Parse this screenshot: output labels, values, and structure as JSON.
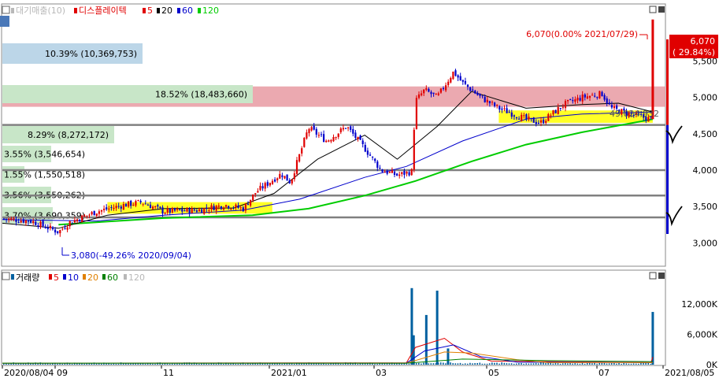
{
  "price_panel": {
    "legend": [
      {
        "label": "대기매출(10)",
        "color": "#b8b8b8"
      },
      {
        "label": "디스플레이텍",
        "color": "#e00000"
      },
      {
        "label": "5",
        "color": "#e00000"
      },
      {
        "label": "20",
        "color": "#000000"
      },
      {
        "label": "60",
        "color": "#0000cc"
      },
      {
        "label": "120",
        "color": "#00cc00"
      }
    ],
    "yaxis_ticks": [
      "5,500",
      "5,000",
      "4,500",
      "4,000",
      "3,500",
      "3,000"
    ],
    "current_price_label": "6,070",
    "current_change_label": "( 29.84%)",
    "high_annotation": "6,070(0.00% 2021/07/29)",
    "low_annotation": "3,080(-49.26% 2020/09/04)",
    "ma_readout": "49,024,932",
    "volume_profile": [
      {
        "label": "10.39% (10,369,753)",
        "color": "#bcd6e8"
      },
      {
        "label": "18.52% (18,483,660)",
        "color": "#c8e6c8"
      },
      {
        "label": "8.29% (8,272,172)",
        "color": "#c8e6c8"
      },
      {
        "label": "3.55% (3,546,654)",
        "color": "#c8e6c8"
      },
      {
        "label": "1.55% (1,550,518)",
        "color": "#c8e6c8"
      },
      {
        "label": "3.56% (3,550,262)",
        "color": "#c8e6c8"
      },
      {
        "label": "3.70% (3,690,359)",
        "color": "#c8e6c8"
      }
    ],
    "colors": {
      "up": "#e00000",
      "down": "#0000cc",
      "ma5": "#e00000",
      "ma20": "#000000",
      "ma60": "#0000cc",
      "ma120": "#00cc00"
    }
  },
  "volume_panel": {
    "legend": [
      {
        "label": "거래량",
        "color": "#000000"
      },
      {
        "label": "5",
        "color": "#e00000"
      },
      {
        "label": "10",
        "color": "#0000cc"
      },
      {
        "label": "20",
        "color": "#e08000"
      },
      {
        "label": "60",
        "color": "#008000"
      },
      {
        "label": "120",
        "color": "#b8b8b8"
      }
    ],
    "yaxis_ticks": [
      "12,000K",
      "6,000K",
      "0K"
    ]
  },
  "xaxis_ticks": [
    "2020/08/04",
    "09",
    "11",
    "2021/01",
    "03",
    "05",
    "07",
    "2021/08/05"
  ],
  "chart_data": {
    "type": "candlestick",
    "price_ylim": [
      2700,
      6100
    ],
    "volume_ylim": [
      0,
      16000
    ],
    "date_range": [
      "2020/08/04",
      "2021/08/05"
    ],
    "price_path": [
      [
        "2020/08/04",
        3330
      ],
      [
        "2020/08/20",
        3300
      ],
      [
        "2020/09/04",
        3150
      ],
      [
        "2020/09/10",
        3280
      ],
      [
        "2020/09/25",
        3430
      ],
      [
        "2020/10/10",
        3520
      ],
      [
        "2020/10/20",
        3560
      ],
      [
        "2020/11/01",
        3430
      ],
      [
        "2020/11/20",
        3450
      ],
      [
        "2020/12/05",
        3520
      ],
      [
        "2020/12/15",
        3470
      ],
      [
        "2020/12/22",
        3700
      ],
      [
        "2021/01/05",
        3950
      ],
      [
        "2021/01/10",
        3830
      ],
      [
        "2021/01/20",
        4580
      ],
      [
        "2021/01/30",
        4400
      ],
      [
        "2021/02/10",
        4600
      ],
      [
        "2021/02/20",
        4300
      ],
      [
        "2021/03/01",
        4000
      ],
      [
        "2021/03/10",
        3930
      ],
      [
        "2021/03/18",
        3980
      ],
      [
        "2021/03/20",
        4950
      ],
      [
        "2021/03/25",
        5100
      ],
      [
        "2021/04/01",
        5000
      ],
      [
        "2021/04/10",
        5350
      ],
      [
        "2021/04/15",
        5200
      ],
      [
        "2021/04/25",
        5000
      ],
      [
        "2021/05/05",
        4850
      ],
      [
        "2021/05/20",
        4700
      ],
      [
        "2021/05/28",
        4650
      ],
      [
        "2021/06/10",
        4900
      ],
      [
        "2021/06/20",
        5000
      ],
      [
        "2021/07/01",
        5050
      ],
      [
        "2021/07/06",
        4850
      ],
      [
        "2021/07/15",
        4780
      ],
      [
        "2021/07/28",
        4700
      ],
      [
        "2021/07/29",
        6070
      ]
    ],
    "ma20_path": [
      [
        "2020/08/04",
        3270
      ],
      [
        "2020/09/04",
        3200
      ],
      [
        "2020/10/01",
        3380
      ],
      [
        "2020/11/01",
        3470
      ],
      [
        "2020/12/10",
        3480
      ],
      [
        "2021/01/01",
        3680
      ],
      [
        "2021/01/25",
        4150
      ],
      [
        "2021/02/20",
        4480
      ],
      [
        "2021/03/10",
        4150
      ],
      [
        "2021/04/01",
        4600
      ],
      [
        "2021/04/20",
        5080
      ],
      [
        "2021/05/20",
        4850
      ],
      [
        "2021/06/20",
        4900
      ],
      [
        "2021/07/10",
        4920
      ],
      [
        "2021/07/29",
        4800
      ]
    ],
    "ma60_path": [
      [
        "2020/08/04",
        3320
      ],
      [
        "2020/09/25",
        3300
      ],
      [
        "2020/11/01",
        3380
      ],
      [
        "2020/12/15",
        3450
      ],
      [
        "2021/01/15",
        3600
      ],
      [
        "2021/02/20",
        3900
      ],
      [
        "2021/03/15",
        4050
      ],
      [
        "2021/04/15",
        4400
      ],
      [
        "2021/05/20",
        4700
      ],
      [
        "2021/06/20",
        4770
      ],
      [
        "2021/07/29",
        4800
      ]
    ],
    "ma120_path": [
      [
        "2020/09/04",
        3250
      ],
      [
        "2020/11/01",
        3340
      ],
      [
        "2020/12/20",
        3380
      ],
      [
        "2021/01/20",
        3470
      ],
      [
        "2021/02/20",
        3650
      ],
      [
        "2021/03/20",
        3850
      ],
      [
        "2021/04/20",
        4120
      ],
      [
        "2021/05/20",
        4350
      ],
      [
        "2021/06/20",
        4520
      ],
      [
        "2021/07/29",
        4700
      ]
    ],
    "horizontal_levels": [
      4620,
      4000,
      3650,
      3350
    ],
    "shaded_bands": [
      {
        "color": "#e89aa2",
        "range": [
          4870,
          5150
        ]
      },
      {
        "color": "#ffff00",
        "range": [
          4650,
          4820
        ],
        "from": "2021/05/05",
        "to": "2021/07/29"
      },
      {
        "color": "#ffff00",
        "range": [
          3400,
          3560
        ],
        "from": "2020/10/01",
        "to": "2020/12/31"
      }
    ],
    "volume_spikes": [
      [
        "2021/03/18",
        15100
      ],
      [
        "2021/03/19",
        5800
      ],
      [
        "2021/03/26",
        9800
      ],
      [
        "2021/04/01",
        14600
      ],
      [
        "2021/04/07",
        3200
      ],
      [
        "2021/07/29",
        10400
      ]
    ]
  }
}
